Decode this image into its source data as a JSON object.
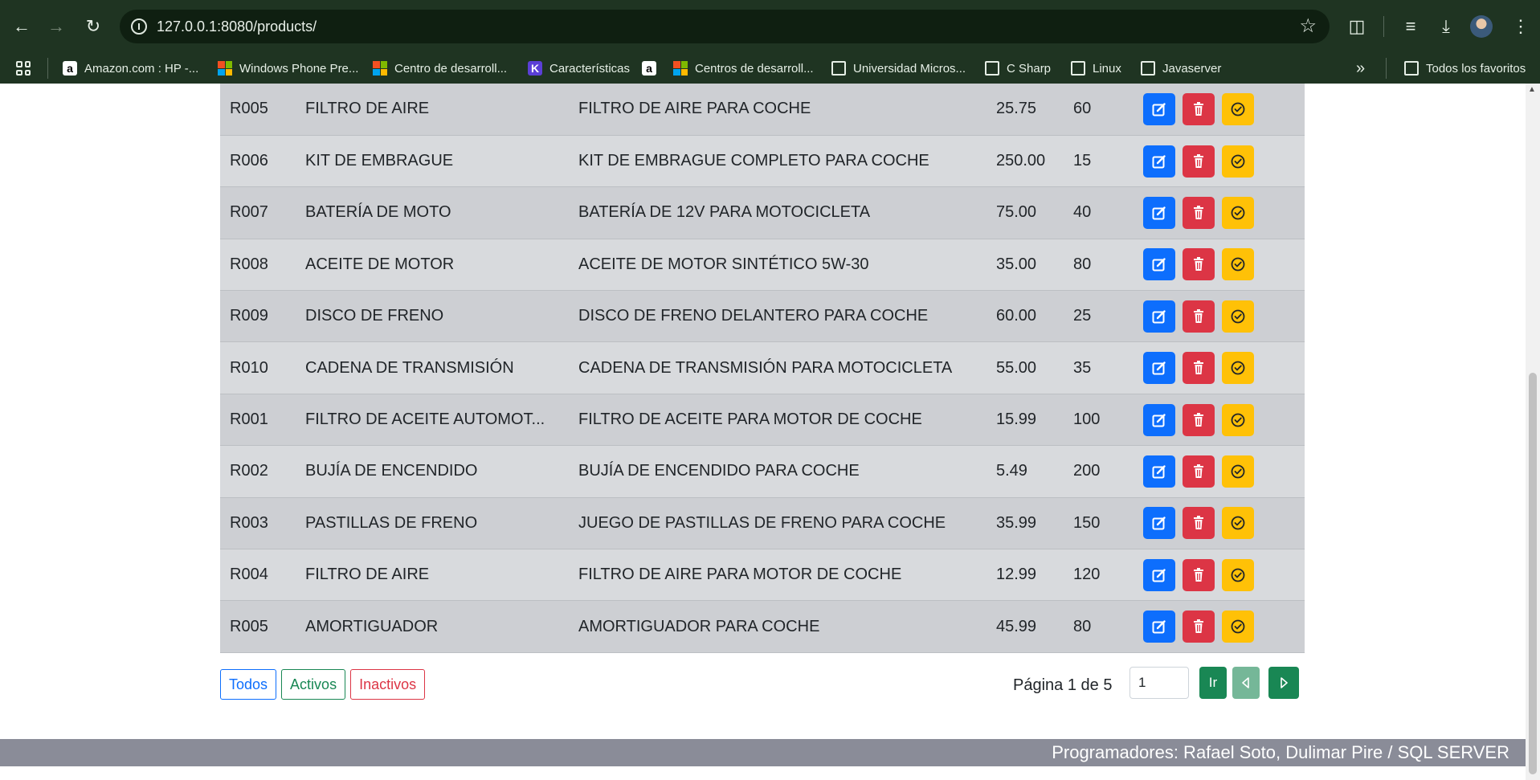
{
  "browser": {
    "url": "127.0.0.1:8080/products/",
    "bookmarks": [
      {
        "label": "Amazon.com : HP -...",
        "icon": "amazon-icon"
      },
      {
        "label": "Windows Phone Pre...",
        "icon": "microsoft-icon"
      },
      {
        "label": "Centro de desarroll...",
        "icon": "microsoft-icon"
      },
      {
        "label": "Características",
        "icon": "k-icon"
      },
      {
        "label": "",
        "icon": "amazon-icon"
      },
      {
        "label": "Centros de desarroll...",
        "icon": "microsoft-icon"
      },
      {
        "label": "Universidad Micros...",
        "icon": "folder-icon"
      },
      {
        "label": "C Sharp",
        "icon": "folder-icon"
      },
      {
        "label": "Linux",
        "icon": "folder-icon"
      },
      {
        "label": "Javaserver",
        "icon": "folder-icon"
      }
    ],
    "more_bookmarks": "»",
    "all_favorites": "Todos los favoritos"
  },
  "products": [
    {
      "code": "R005",
      "name": "FILTRO DE AIRE",
      "description": "FILTRO DE AIRE PARA COCHE",
      "price": "25.75",
      "stock": "60"
    },
    {
      "code": "R006",
      "name": "KIT DE EMBRAGUE",
      "description": "KIT DE EMBRAGUE COMPLETO PARA COCHE",
      "price": "250.00",
      "stock": "15"
    },
    {
      "code": "R007",
      "name": "BATERÍA DE MOTO",
      "description": "BATERÍA DE 12V PARA MOTOCICLETA",
      "price": "75.00",
      "stock": "40"
    },
    {
      "code": "R008",
      "name": "ACEITE DE MOTOR",
      "description": "ACEITE DE MOTOR SINTÉTICO 5W-30",
      "price": "35.00",
      "stock": "80"
    },
    {
      "code": "R009",
      "name": "DISCO DE FRENO",
      "description": "DISCO DE FRENO DELANTERO PARA COCHE",
      "price": "60.00",
      "stock": "25"
    },
    {
      "code": "R010",
      "name": "CADENA DE TRANSMISIÓN",
      "description": "CADENA DE TRANSMISIÓN PARA MOTOCICLETA",
      "price": "55.00",
      "stock": "35"
    },
    {
      "code": "R001",
      "name": "FILTRO DE ACEITE AUTOMOT...",
      "description": "FILTRO DE ACEITE PARA MOTOR DE COCHE",
      "price": "15.99",
      "stock": "100"
    },
    {
      "code": "R002",
      "name": "BUJÍA DE ENCENDIDO",
      "description": "BUJÍA DE ENCENDIDO PARA COCHE",
      "price": "5.49",
      "stock": "200"
    },
    {
      "code": "R003",
      "name": "PASTILLAS DE FRENO",
      "description": "JUEGO DE PASTILLAS DE FRENO PARA COCHE",
      "price": "35.99",
      "stock": "150"
    },
    {
      "code": "R004",
      "name": "FILTRO DE AIRE",
      "description": "FILTRO DE AIRE PARA MOTOR DE COCHE",
      "price": "12.99",
      "stock": "120"
    },
    {
      "code": "R005",
      "name": "AMORTIGUADOR",
      "description": "AMORTIGUADOR PARA COCHE",
      "price": "45.99",
      "stock": "80"
    }
  ],
  "filters": {
    "all": "Todos",
    "active": "Activos",
    "inactive": "Inactivos"
  },
  "pagination": {
    "text": "Página 1 de 5",
    "input_value": "1",
    "go_label": "Ir"
  },
  "footer": {
    "text": "Programadores: Rafael Soto, Dulimar Pire / SQL SERVER"
  },
  "colors": {
    "edit": "#0d6efd",
    "delete": "#dc3545",
    "activate": "#ffc107",
    "success": "#198754",
    "footer": "#8a8c98"
  }
}
